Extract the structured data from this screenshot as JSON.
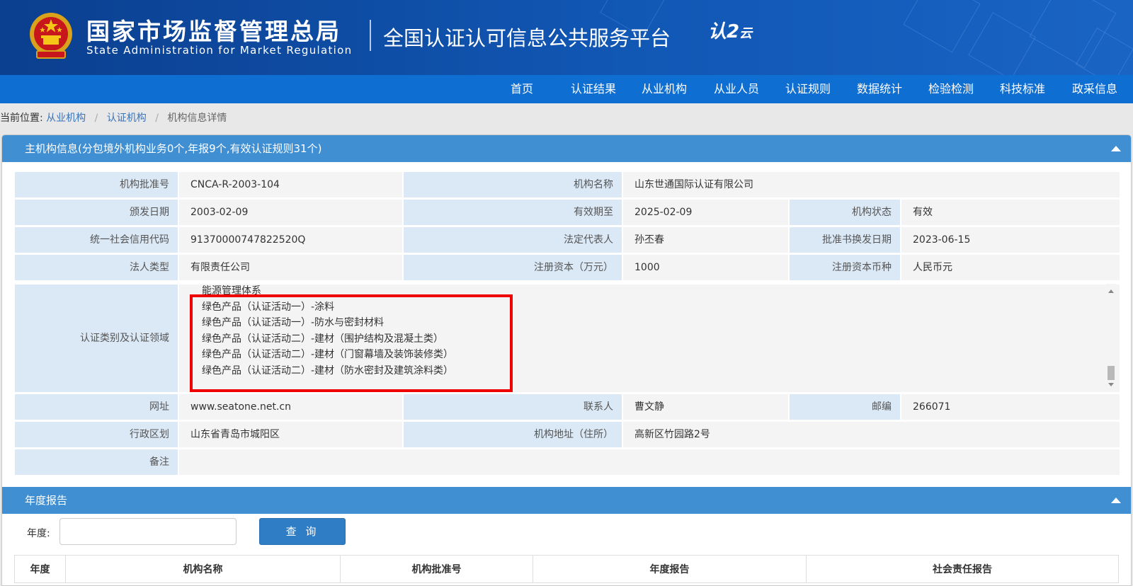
{
  "header": {
    "title_cn": "国家市场监督管理总局",
    "title_en": "State Administration  for  Market Regulation",
    "platform": "全国认证认可信息公共服务平台",
    "cloud_logo_main": "认2",
    "cloud_logo_sub": "云"
  },
  "nav": [
    "首页",
    "认证结果",
    "从业机构",
    "从业人员",
    "认证规则",
    "数据统计",
    "检验检测",
    "科技标准",
    "政采信息"
  ],
  "breadcrumb": {
    "prefix": "当前位置:",
    "items": [
      "从业机构",
      "认证机构"
    ],
    "current": "机构信息详情",
    "separator": "/"
  },
  "main_panel": {
    "title": "主机构信息(分包境外机构业务0个,年报9个,有效认证规则31个)",
    "fields": {
      "approval_no": {
        "label": "机构批准号",
        "value": "CNCA-R-2003-104"
      },
      "org_name": {
        "label": "机构名称",
        "value": "山东世通国际认证有限公司"
      },
      "issue_date": {
        "label": "颁发日期",
        "value": "2003-02-09"
      },
      "valid_until": {
        "label": "有效期至",
        "value": "2025-02-09"
      },
      "org_status": {
        "label": "机构状态",
        "value": "有效"
      },
      "credit_code": {
        "label": "统一社会信用代码",
        "value": "91370000747822520Q"
      },
      "legal_rep": {
        "label": "法定代表人",
        "value": "孙丕春"
      },
      "renewal_date": {
        "label": "批准书换发日期",
        "value": "2023-06-15"
      },
      "legal_type": {
        "label": "法人类型",
        "value": "有限责任公司"
      },
      "reg_capital": {
        "label": "注册资本（万元）",
        "value": "1000"
      },
      "capital_currency": {
        "label": "注册资本币种",
        "value": "人民币元"
      },
      "cert_domain": {
        "label": "认证类别及认证领域",
        "items": [
          "能源管理体系",
          "绿色产品（认证活动一）-涂料",
          "绿色产品（认证活动一）-防水与密封材料",
          "绿色产品（认证活动二）-建材（围护结构及混凝土类）",
          "绿色产品（认证活动二）-建材（门窗幕墙及装饰装修类）",
          "绿色产品（认证活动二）-建材（防水密封及建筑涂料类）"
        ]
      },
      "website": {
        "label": "网址",
        "value": "www.seatone.net.cn"
      },
      "contact": {
        "label": "联系人",
        "value": "曹文静"
      },
      "postcode": {
        "label": "邮编",
        "value": "266071"
      },
      "region": {
        "label": "行政区划",
        "value": "山东省青岛市城阳区"
      },
      "address": {
        "label": "机构地址（住所）",
        "value": "高新区竹园路2号"
      },
      "remark": {
        "label": "备注",
        "value": ""
      }
    }
  },
  "annual_panel": {
    "title": "年度报告",
    "year_label": "年度:",
    "year_value": "",
    "query_button": "查 询",
    "columns": [
      "年度",
      "机构名称",
      "机构批准号",
      "年度报告",
      "社会责任报告"
    ]
  },
  "colors": {
    "header_dark": "#0b3f8f",
    "nav_blue": "#0f6ed2",
    "panel_head": "#3f8fd2",
    "label_bg": "#dbe9f6",
    "highlight_red": "#ee0000"
  }
}
